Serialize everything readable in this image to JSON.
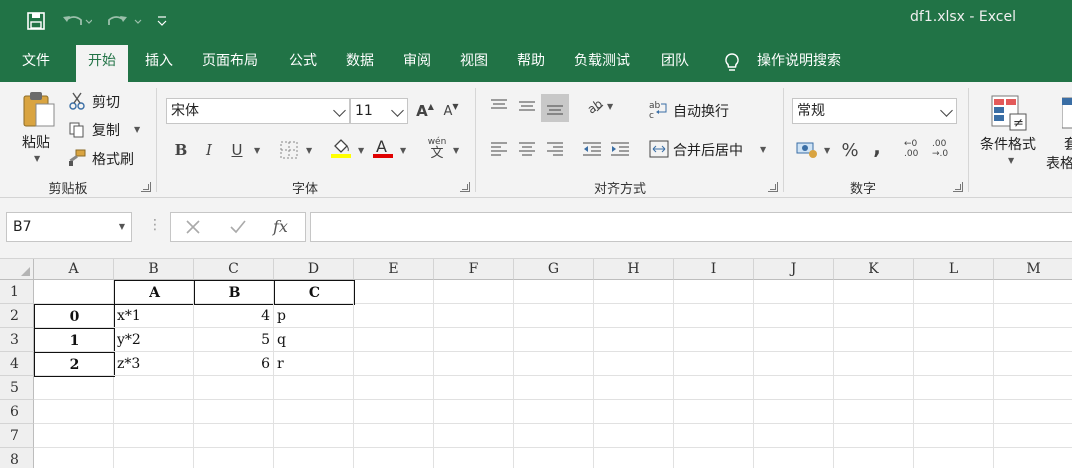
{
  "window": {
    "title": "df1.xlsx  -  Excel"
  },
  "ribbon_tabs": [
    "文件",
    "开始",
    "插入",
    "页面布局",
    "公式",
    "数据",
    "审阅",
    "视图",
    "帮助",
    "负载测试",
    "团队",
    "操作说明搜索"
  ],
  "clipboard": {
    "paste": "粘贴",
    "cut": "剪切",
    "copy": "复制",
    "format_painter": "格式刷",
    "group": "剪贴板"
  },
  "font": {
    "name": "宋体",
    "size": "11",
    "bold": "B",
    "italic": "I",
    "underline": "U",
    "font_color_glyph": "A",
    "grow": "A",
    "shrink": "A",
    "phonetic_top": "wén",
    "phonetic_bottom": "文",
    "group": "字体"
  },
  "alignment": {
    "wrap_text": "自动换行",
    "merge_center": "合并后居中",
    "group": "对齐方式"
  },
  "number": {
    "format": "常规",
    "percent": "%",
    "comma": ",",
    "inc_decimal_top": "←0",
    "inc_decimal_bottom": ".00",
    "dec_decimal_top": ".00",
    "dec_decimal_bottom": "→.0",
    "group": "数字"
  },
  "styles": {
    "conditional": "条件格式",
    "table_partial": "套",
    "table_partial2": "表格"
  },
  "formula_bar": {
    "name_box": "B7",
    "fx": "fx",
    "formula": ""
  },
  "columns": [
    "A",
    "B",
    "C",
    "D",
    "E",
    "F",
    "G",
    "H",
    "I",
    "J",
    "K",
    "L",
    "M"
  ],
  "rows": [
    "1",
    "2",
    "3",
    "4",
    "5",
    "6",
    "7",
    "8"
  ],
  "cells": {
    "B1": "A",
    "C1": "B",
    "D1": "C",
    "A2": "0",
    "B2": "x*1",
    "C2": "4",
    "D2": "p",
    "A3": "1",
    "B3": "y*2",
    "C3": "5",
    "D3": "q",
    "A4": "2",
    "B4": "z*3",
    "C4": "6",
    "D4": "r"
  },
  "colors": {
    "excel_green": "#217346",
    "ribbon_bg": "#f3f3f3",
    "fill_yellow": "#ffff00",
    "font_red": "#e00000"
  }
}
